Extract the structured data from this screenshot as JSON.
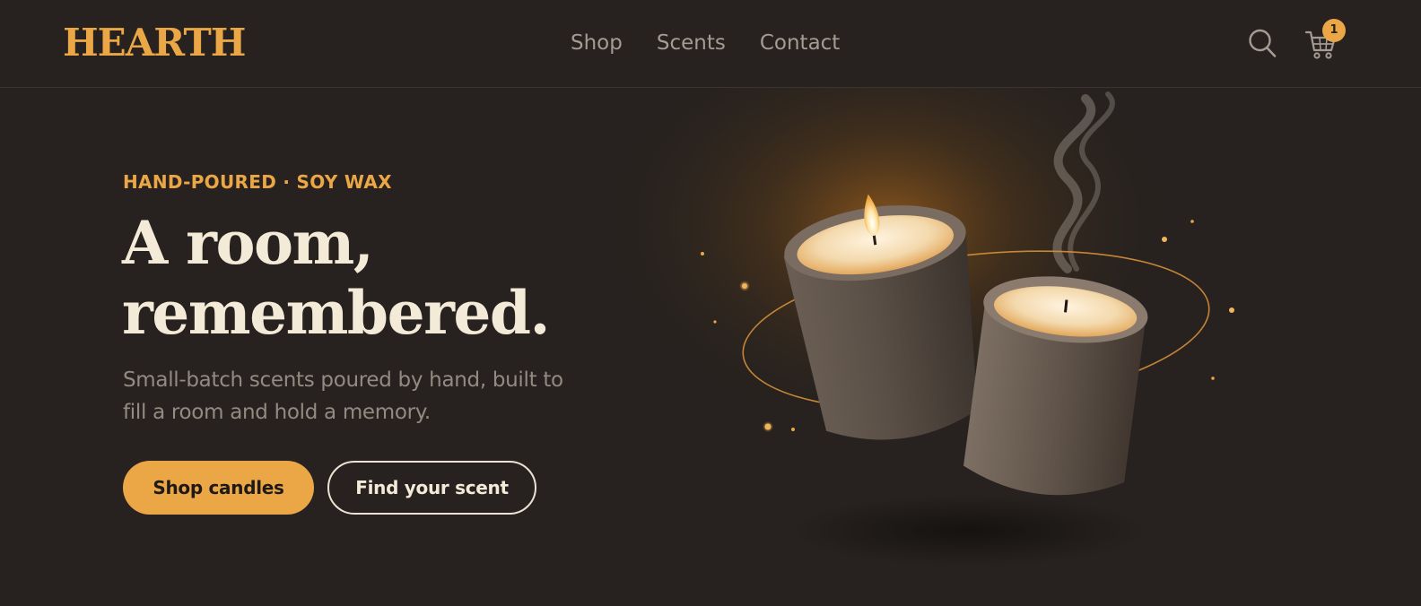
{
  "brand": {
    "name": "HEARTH",
    "accent_color": "#eba746"
  },
  "nav": {
    "links": [
      {
        "label": "Shop"
      },
      {
        "label": "Scents"
      },
      {
        "label": "Contact"
      }
    ],
    "search_icon": "search-icon",
    "cart_icon": "cart-icon",
    "cart_count": "1"
  },
  "hero": {
    "eyebrow": "HAND-POURED · SOY WAX",
    "headline_line1": "A room,",
    "headline_line2": "remembered.",
    "subcopy": "Small-batch scents poured by hand, built to fill a room and hold a memory.",
    "primary_cta": "Shop candles",
    "secondary_cta": "Find your scent"
  },
  "colors": {
    "background": "#27221f",
    "headline": "#f3ead8",
    "body_text": "#938a82",
    "nav_text": "#a49b93"
  }
}
